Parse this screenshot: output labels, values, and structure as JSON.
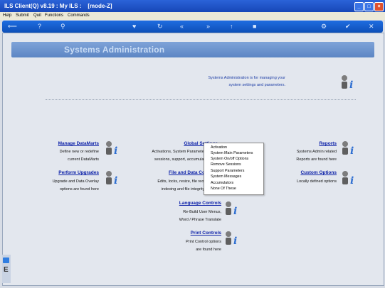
{
  "window": {
    "title": "ILS Client(Q) v8.19 : My ILS :    [mode-Z]"
  },
  "menu": [
    "Help",
    "Submit",
    "Quit",
    "Functions",
    "Commands"
  ],
  "toolbar_icons": [
    "back-arrow-icon",
    "help-icon",
    "search-icon",
    "heart-icon",
    "refresh-icon",
    "rewind-icon",
    "forward-icon",
    "up-icon",
    "stop-icon",
    "gear-icon",
    "check-icon",
    "close-icon"
  ],
  "banner": {
    "title": "Systems Administration"
  },
  "intro": {
    "line1": "Systems Administration is for managing your",
    "line2": "system settings and parameters."
  },
  "sections": {
    "manage": {
      "title": "Manage DataMarts",
      "line1": "Define new or redefine",
      "line2": "current DataMarts"
    },
    "upgrades": {
      "title": "Perform Upgrades",
      "line1": "Upgrade and Data Overlay",
      "line2": "options are found here"
    },
    "global": {
      "title": "Global Settings",
      "line1": "Activations, System Parameters, login",
      "line2": "sessions, support, accumulators, etc"
    },
    "file": {
      "title": "File and Data Controls",
      "line1": "Edits, locks, resize, file reorganise,",
      "line2": "indexing and file integrity checks"
    },
    "reports": {
      "title": "Reports",
      "line1": "Systems Admin related",
      "line2": "Reports are found here"
    },
    "custom": {
      "title": "Custom Options",
      "line1": "Locally defined options"
    },
    "language": {
      "title": "Language Controls",
      "line1": "Re-Build User Menus,",
      "line2": "Word / Phrase Translate"
    },
    "print": {
      "title": "Print Controls",
      "line1": "Print Control options",
      "line2": "are found here"
    }
  },
  "popup_menu": [
    "Activation",
    "System Main Parameters",
    "System On/off Options",
    "Remove Sessions",
    "Support Parameters",
    "System Messages",
    "Accumulators",
    "None Of These"
  ],
  "bottom": {
    "label": "E"
  }
}
